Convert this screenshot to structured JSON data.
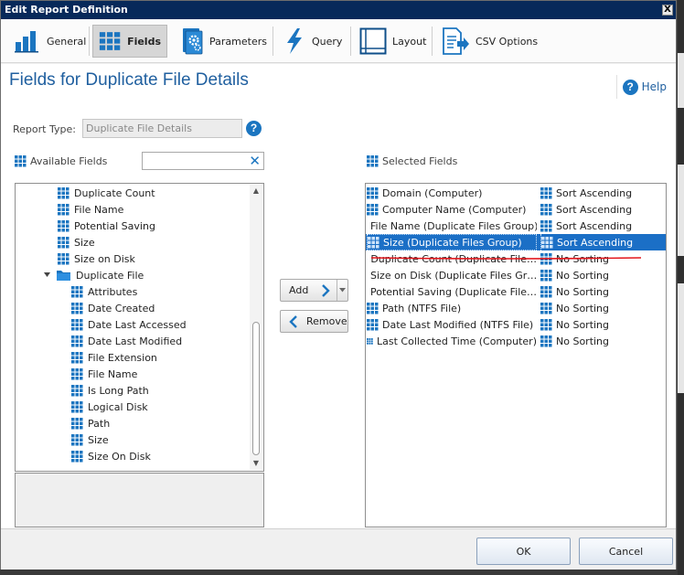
{
  "window": {
    "title": "Edit Report Definition",
    "close_label": "X"
  },
  "ribbon": {
    "tabs": [
      {
        "label": "General",
        "icon": "bar-chart-icon"
      },
      {
        "label": "Fields",
        "icon": "grid-icon"
      },
      {
        "label": "Parameters",
        "icon": "parameters-gear-icon"
      },
      {
        "label": "Query",
        "icon": "lightning-icon"
      },
      {
        "label": "Layout",
        "icon": "layout-icon"
      },
      {
        "label": "CSV Options",
        "icon": "csv-export-icon"
      }
    ],
    "active_tab": "Fields"
  },
  "page": {
    "title": "Fields for Duplicate File Details",
    "help_label": "Help"
  },
  "report_type": {
    "label": "Report Type:",
    "value": "Duplicate File Details"
  },
  "available": {
    "label": "Available Fields",
    "search_value": ""
  },
  "tree": {
    "items": [
      {
        "label": "Duplicate Count",
        "level": 1,
        "type": "field"
      },
      {
        "label": "File Name",
        "level": 1,
        "type": "field"
      },
      {
        "label": "Potential Saving",
        "level": 1,
        "type": "field"
      },
      {
        "label": "Size",
        "level": 1,
        "type": "field"
      },
      {
        "label": "Size on Disk",
        "level": 1,
        "type": "field"
      },
      {
        "label": "Duplicate File",
        "level": 0,
        "type": "folder"
      },
      {
        "label": "Attributes",
        "level": 2,
        "type": "field"
      },
      {
        "label": "Date Created",
        "level": 2,
        "type": "field"
      },
      {
        "label": "Date Last Accessed",
        "level": 2,
        "type": "field"
      },
      {
        "label": "Date Last Modified",
        "level": 2,
        "type": "field"
      },
      {
        "label": "File Extension",
        "level": 2,
        "type": "field"
      },
      {
        "label": "File Name",
        "level": 2,
        "type": "field"
      },
      {
        "label": "Is Long Path",
        "level": 2,
        "type": "field"
      },
      {
        "label": "Logical Disk",
        "level": 2,
        "type": "field"
      },
      {
        "label": "Path",
        "level": 2,
        "type": "field"
      },
      {
        "label": "Size",
        "level": 2,
        "type": "field"
      },
      {
        "label": "Size On Disk",
        "level": 2,
        "type": "field"
      }
    ]
  },
  "buttons": {
    "add": "Add",
    "remove": "Remove",
    "ok": "OK",
    "cancel": "Cancel"
  },
  "selected": {
    "label": "Selected Fields",
    "rows": [
      {
        "field": "Domain (Computer)",
        "sort": "Sort Ascending",
        "selected": false
      },
      {
        "field": "Computer Name (Computer)",
        "sort": "Sort Ascending",
        "selected": false
      },
      {
        "field": "File Name (Duplicate Files Group)",
        "sort": "Sort Ascending",
        "selected": false
      },
      {
        "field": "Size (Duplicate Files Group)",
        "sort": "Sort Ascending",
        "selected": true
      },
      {
        "field": "Duplicate Count (Duplicate File…",
        "sort": "No Sorting",
        "selected": false
      },
      {
        "field": "Size on Disk (Duplicate Files Gr…",
        "sort": "No Sorting",
        "selected": false
      },
      {
        "field": "Potential Saving (Duplicate File…",
        "sort": "No Sorting",
        "selected": false
      },
      {
        "field": "Path (NTFS File)",
        "sort": "No Sorting",
        "selected": false
      },
      {
        "field": "Date Last Modified (NTFS File)",
        "sort": "No Sorting",
        "selected": false
      },
      {
        "field": "Last Collected Time (Computer)",
        "sort": "No Sorting",
        "selected": false
      }
    ]
  },
  "colors": {
    "accent": "#1f5f9f",
    "selection": "#1b6fc6",
    "titlebar": "#07295a",
    "annotation": "#e3161c"
  }
}
